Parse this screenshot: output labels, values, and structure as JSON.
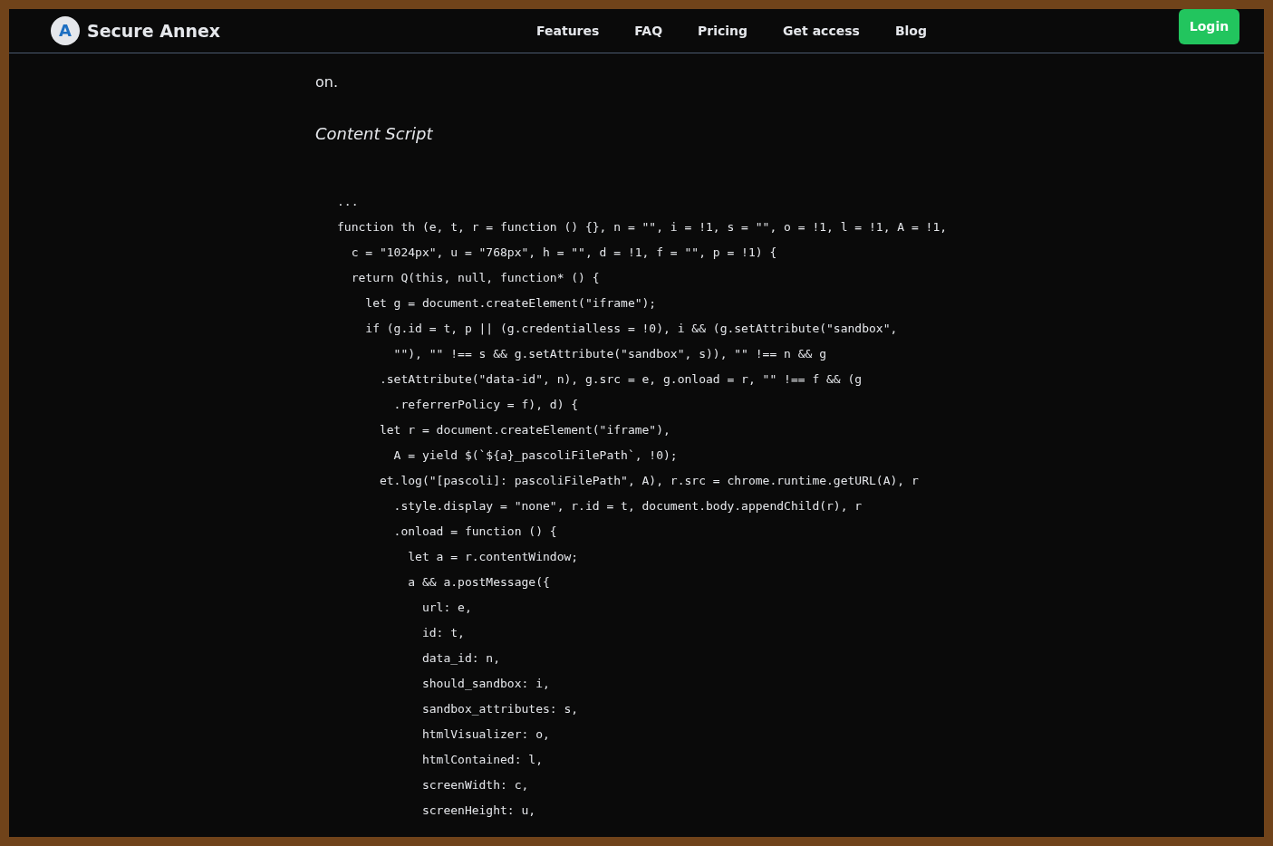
{
  "header": {
    "brand": "Secure Annex",
    "logo_letter": "A",
    "nav": [
      "Features",
      "FAQ",
      "Pricing",
      "Get access",
      "Blog"
    ],
    "login": "Login"
  },
  "article": {
    "paragraph_end": "on.",
    "heading": "Content Script",
    "code_lines": [
      "...",
      "function th (e, t, r = function () {}, n = \"\", i = !1, s = \"\", o = !1, l = !1, A = !1,",
      "  c = \"1024px\", u = \"768px\", h = \"\", d = !1, f = \"\", p = !1) {",
      "  return Q(this, null, function* () {",
      "    let g = document.createElement(\"iframe\");",
      "    if (g.id = t, p || (g.credentialless = !0), i && (g.setAttribute(\"sandbox\",",
      "        \"\"), \"\" !== s && g.setAttribute(\"sandbox\", s)), \"\" !== n && g",
      "      .setAttribute(\"data-id\", n), g.src = e, g.onload = r, \"\" !== f && (g",
      "        .referrerPolicy = f), d) {",
      "      let r = document.createElement(\"iframe\"),",
      "        A = yield $(`${a}_pascoliFilePath`, !0);",
      "      et.log(\"[pascoli]: pascoliFilePath\", A), r.src = chrome.runtime.getURL(A), r",
      "        .style.display = \"none\", r.id = t, document.body.appendChild(r), r",
      "        .onload = function () {",
      "          let a = r.contentWindow;",
      "          a && a.postMessage({",
      "            url: e,",
      "            id: t,",
      "            data_id: n,",
      "            should_sandbox: i,",
      "            sandbox_attributes: s,",
      "            htmlVisualizer: o,",
      "            htmlContained: l,",
      "            screenWidth: c,",
      "            screenHeight: u,"
    ]
  }
}
